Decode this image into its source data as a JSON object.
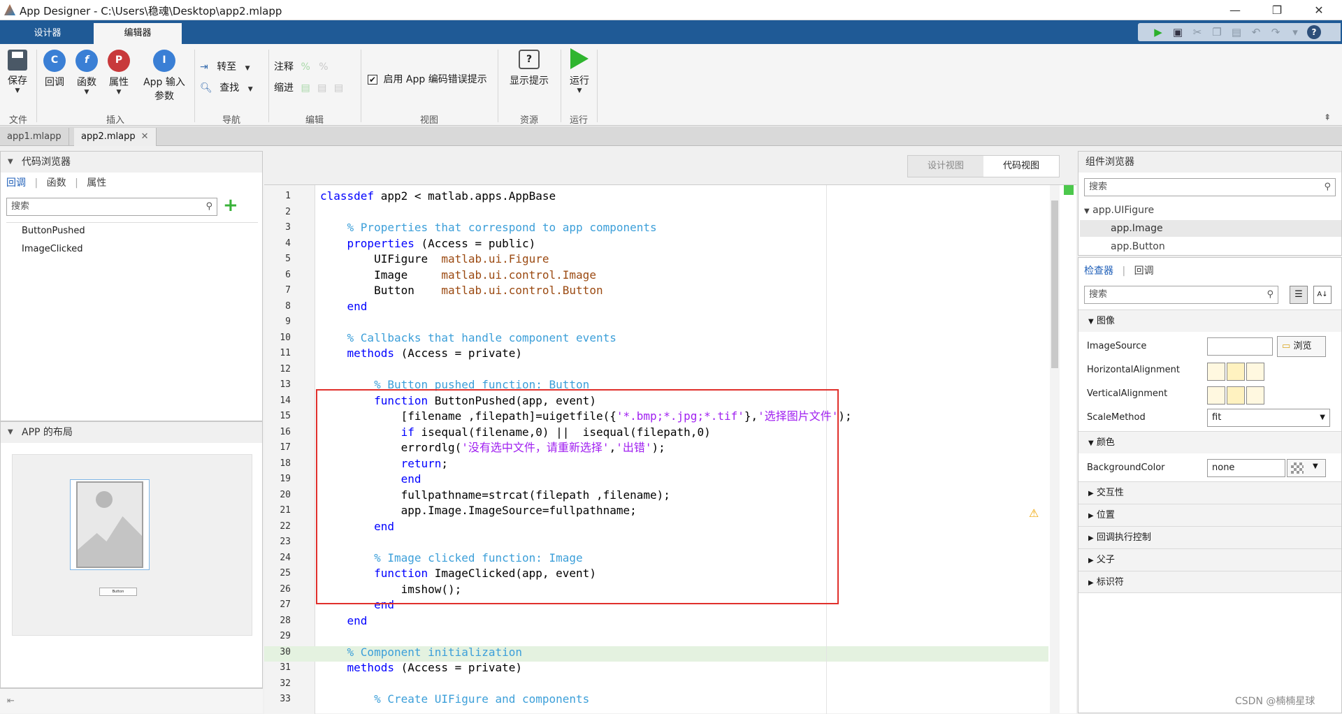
{
  "window": {
    "title": "App Designer - C:\\Users\\稳魂\\Desktop\\app2.mlapp",
    "min": "—",
    "restore": "❐",
    "close": "✕"
  },
  "tabs": {
    "design": "设计器",
    "editor": "编辑器"
  },
  "ribbon": {
    "save": "保存",
    "file_group": "文件",
    "callback": "回调",
    "function": "函数",
    "property": "属性",
    "app_input_1": "App 输入",
    "app_input_2": "参数",
    "insert_group": "插入",
    "goto": "转至",
    "find": "查找",
    "nav_group": "导航",
    "comment": "注释",
    "indent": "缩进",
    "edit_group": "编辑",
    "enable_hint": "启用 App 编码错误提示",
    "view_group": "视图",
    "show_tips": "显示提示",
    "resources_group": "资源",
    "run": "运行",
    "run_group": "运行"
  },
  "doc_tabs": [
    "app1.mlapp",
    "app2.mlapp"
  ],
  "code_browser": {
    "title": "代码浏览器",
    "tabs": [
      "回调",
      "函数",
      "属性"
    ],
    "search_placeholder": "搜索",
    "items": [
      "ButtonPushed",
      "ImageClicked"
    ]
  },
  "layout_panel": {
    "title": "APP 的布局",
    "button_text": "Button"
  },
  "view_toggle": {
    "design": "设计视图",
    "code": "代码视图"
  },
  "editor": {
    "line_numbers": [
      "1",
      "2",
      "3",
      "4",
      "5",
      "6",
      "7",
      "8",
      "9",
      "10",
      "11",
      "12",
      "13",
      "14",
      "15",
      "16",
      "17",
      "18",
      "19",
      "20",
      "21",
      "22",
      "23",
      "24",
      "25",
      "26",
      "27",
      "28",
      "29",
      "30",
      "31",
      "32",
      "33"
    ]
  },
  "component_browser": {
    "title": "组件浏览器",
    "search_placeholder": "搜索",
    "tree": [
      "app.UIFigure",
      "app.Image",
      "app.Button"
    ]
  },
  "inspector": {
    "tabs": [
      "检查器",
      "回调"
    ],
    "search_placeholder": "搜索",
    "sections": {
      "image": "图像",
      "color": "颜色",
      "interactivity": "交互性",
      "position": "位置",
      "callback_exec": "回调执行控制",
      "parent_child": "父子",
      "identifier": "标识符"
    },
    "props": {
      "image_source": "ImageSource",
      "browse": "浏览",
      "h_align": "HorizontalAlignment",
      "v_align": "VerticalAlignment",
      "scale": "ScaleMethod",
      "scale_value": "fit",
      "bgcolor": "BackgroundColor",
      "bgcolor_value": "none"
    }
  },
  "watermark": "CSDN @楠楠星球"
}
